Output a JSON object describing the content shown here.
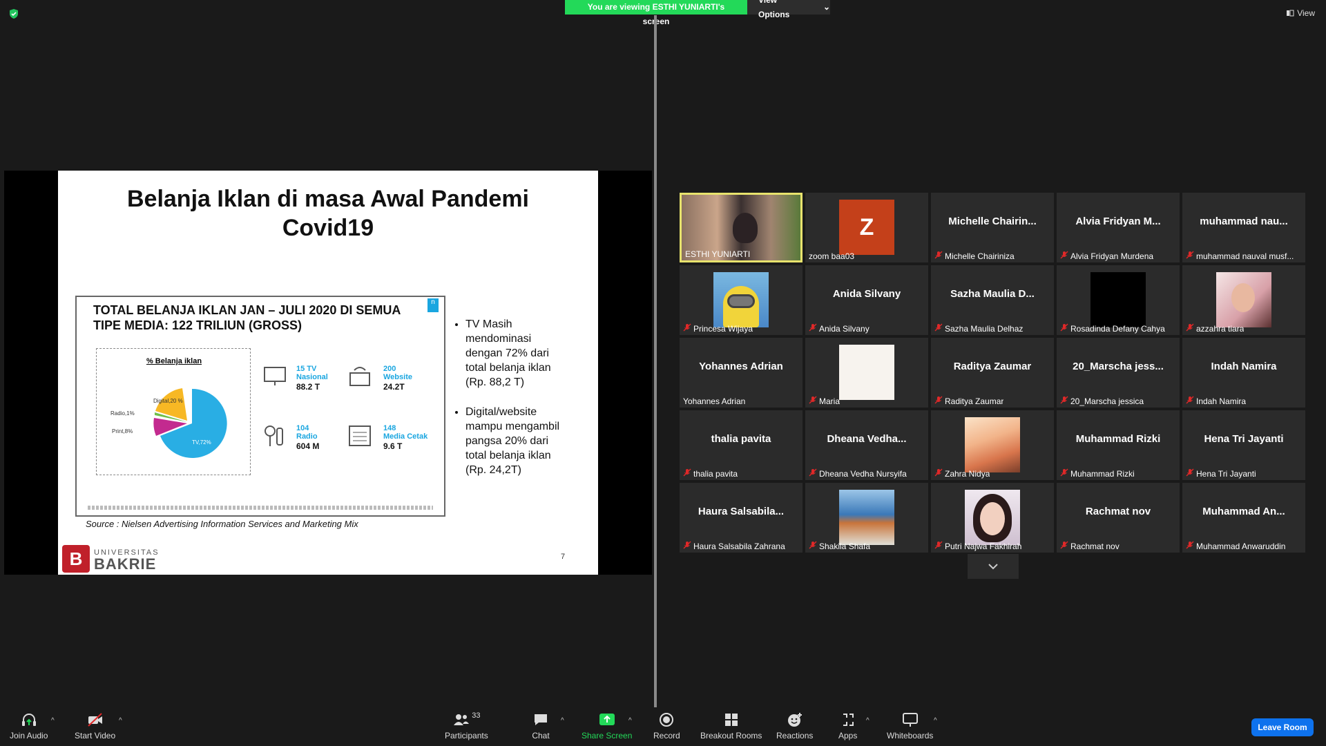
{
  "banner": {
    "viewing": "You are viewing ESTHI YUNIARTI's screen",
    "view_options": "View Options"
  },
  "top_view": "View",
  "slide": {
    "title_line1": "Belanja Iklan di masa Awal Pandemi",
    "title_line2": "Covid19",
    "inner_title": "TOTAL BELANJA IKLAN JAN – JULI 2020 DI SEMUA TIPE MEDIA: 122 TRILIUN (GROSS)",
    "pie_title": "% Belanja iklan",
    "pie_labels": {
      "tv": "TV,72%",
      "digital": "Digital,20 %",
      "radio": "Radio,1%",
      "print": "Print,8%"
    },
    "stats": [
      {
        "count": "15 TV",
        "type": "Nasional",
        "value": "88.2 T"
      },
      {
        "count": "200",
        "type": "Website",
        "value": "24.2T"
      },
      {
        "count": "104",
        "type": "Radio",
        "value": "604 M"
      },
      {
        "count": "148",
        "type": "Media Cetak",
        "value": "9.6 T"
      }
    ],
    "bullet1": "TV Masih mendominasi dengan 72% dari total belanja iklan (Rp. 88,2 T)",
    "bullet2": "Digital/website mampu mengambil pangsa 20%  dari total belanja iklan (Rp. 24,2T)",
    "source": "Source : Nielsen Advertising Information Services and Marketing Mix",
    "page_number": "7",
    "logo_small": "UNIVERSITAS",
    "logo_big": "BAKRIE"
  },
  "tiles": [
    {
      "display": "",
      "label": "ESTHI YUNIARTI",
      "muted": false,
      "kind": "video"
    },
    {
      "display": "",
      "label": "zoom baa03",
      "muted": false,
      "kind": "avatar-z"
    },
    {
      "display": "Michelle  Chairin...",
      "label": "Michelle Chairiniza",
      "muted": true
    },
    {
      "display": "Alvia  Fridyan  M...",
      "label": "Alvia Fridyan Murdena",
      "muted": true
    },
    {
      "display": "muhammad  nau...",
      "label": "muhammad nauval musf...",
      "muted": true
    },
    {
      "display": "",
      "label": "Princesa Wijaya",
      "muted": true,
      "kind": "minion"
    },
    {
      "display": "Anida Silvany",
      "label": "Anida Silvany",
      "muted": true
    },
    {
      "display": "Sazha  Maulia  D...",
      "label": "Sazha Maulia Delhaz",
      "muted": true
    },
    {
      "display": "",
      "label": "Rosadinda Defany Cahya",
      "muted": true,
      "kind": "black"
    },
    {
      "display": "",
      "label": "azzahra tiara",
      "muted": true,
      "kind": "photo-girl"
    },
    {
      "display": "Yohannes Adrian",
      "label": "Yohannes Adrian",
      "muted": false
    },
    {
      "display": "",
      "label": "Maria",
      "muted": true,
      "kind": "blank"
    },
    {
      "display": "Raditya Zaumar",
      "label": "Raditya Zaumar",
      "muted": true
    },
    {
      "display": "20_Marscha  jess...",
      "label": "20_Marscha jessica",
      "muted": true
    },
    {
      "display": "Indah Namira",
      "label": "Indah Namira",
      "muted": true
    },
    {
      "display": "thalia pavita",
      "label": "thalia pavita",
      "muted": true
    },
    {
      "display": "Dheana  Vedha...",
      "label": "Dheana Vedha Nursyifa",
      "muted": true
    },
    {
      "display": "",
      "label": "Zahra Nidya",
      "muted": true,
      "kind": "sunset"
    },
    {
      "display": "Muhammad Rizki",
      "label": "Muhammad Rizki",
      "muted": true
    },
    {
      "display": "Hena Tri Jayanti",
      "label": "Hena Tri Jayanti",
      "muted": true
    },
    {
      "display": "Haura  Salsabila...",
      "label": "Haura Salsabila Zahrana",
      "muted": true
    },
    {
      "display": "",
      "label": "Shakila Shafa",
      "muted": true,
      "kind": "food"
    },
    {
      "display": "",
      "label": "Putri Najwa Fakhirah",
      "muted": true,
      "kind": "photo-face"
    },
    {
      "display": "Rachmat nov",
      "label": "Rachmat nov",
      "muted": true
    },
    {
      "display": "Muhammad  An...",
      "label": "Muhammad Anwaruddin",
      "muted": true
    }
  ],
  "avatar_letter": "Z",
  "toolbar": {
    "join_audio": "Join Audio",
    "start_video": "Start Video",
    "participants": "Participants",
    "participants_count": "33",
    "chat": "Chat",
    "share_screen": "Share Screen",
    "record": "Record",
    "breakout": "Breakout Rooms",
    "reactions": "Reactions",
    "apps": "Apps",
    "whiteboards": "Whiteboards",
    "leave": "Leave Room"
  },
  "colors": {
    "share_green": "#23d959",
    "leave_blue": "#0e72ed",
    "active_border": "#e8e36d",
    "muted_red": "#e02828"
  }
}
